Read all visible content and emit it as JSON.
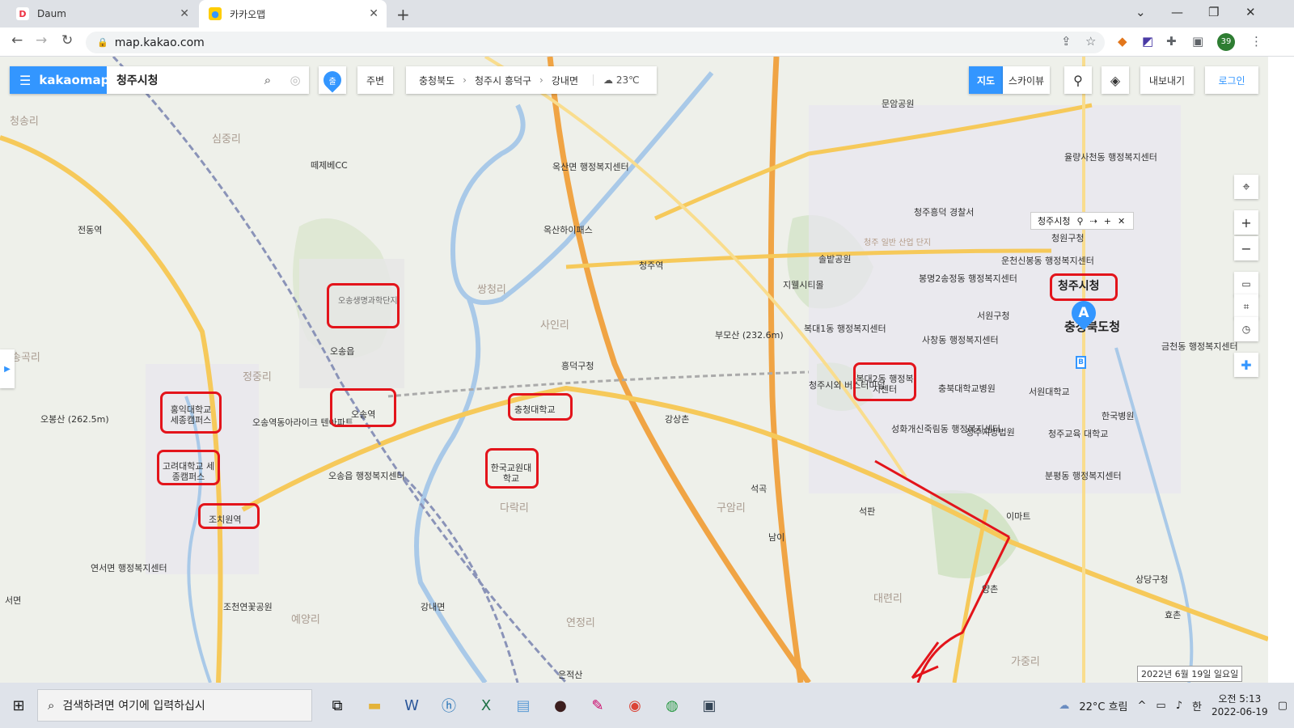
{
  "browser": {
    "tabs": [
      {
        "label": "Daum",
        "active": false
      },
      {
        "label": "카카오맵",
        "active": true
      }
    ],
    "new_tab": "+",
    "url": "map.kakao.com",
    "profile_initials": "39"
  },
  "kakaomap": {
    "logo": "kakaomap",
    "search_value": "청주시청",
    "departure_label": "출",
    "nearby_label": "주변",
    "breadcrumb": [
      "충청북도",
      "청주시 흥덕구",
      "강내면"
    ],
    "weather": "23℃",
    "view_modes": {
      "map": "지도",
      "skyview": "스카이뷰"
    },
    "export_label": "내보내기",
    "login_label": "로그인",
    "popup_title": "청주시청",
    "pin_a": "A",
    "pin_b": "B",
    "date_badge": "2022년 6월 19일 일요일"
  },
  "map_labels": [
    "오송생명과학단지",
    "오송역",
    "충청대학교",
    "한국교원대학교",
    "홍익대학교 세종캠퍼스",
    "고려대학교 세종캠퍼스",
    "조치원역",
    "복대2동 행정복지센터",
    "청주시청",
    "충청북도청",
    "오송읍",
    "흥덕구청",
    "부모산 (232.6m)",
    "옥산면 행정복지센터",
    "옥산하이패스",
    "청주역",
    "강상촌",
    "석곡",
    "남이",
    "석판",
    "이마트",
    "양촌",
    "상당구청",
    "효촌",
    "서원구청",
    "사창동 행정복지센터",
    "봉명2송정동 행정복지센터",
    "운천신봉동 행정복지센터",
    "청원구청",
    "청주흥덕 경찰서",
    "충북대학교병원",
    "서원대학교",
    "한국병원",
    "분평동 행정복지센터",
    "오송읍 행정복지센터",
    "연서면 행정복지센터",
    "오봉산 (262.5m)",
    "전동역",
    "오송역동아라이크 텐아파트",
    "지웰시티몰",
    "복대1동 행정복지센터",
    "강내면",
    "떼제베CC",
    "청주시외 버스터미널",
    "성화개신죽림동 행정복지센터",
    "은적산",
    "조천연꽃공원",
    "서면",
    "청주지방법원",
    "청주교육 대학교",
    "율량사천동 행정복지센터",
    "문암공원",
    "솔밭공원",
    "청주 일반 산업 단지",
    "청주시외 버스터미널",
    "금천동 행정복지센터"
  ],
  "taskbar": {
    "search_placeholder": "검색하려면 여기에 입력하십시",
    "weather": "22°C 흐림",
    "ime": "한",
    "time": "오전 5:13",
    "date": "2022-06-19"
  }
}
